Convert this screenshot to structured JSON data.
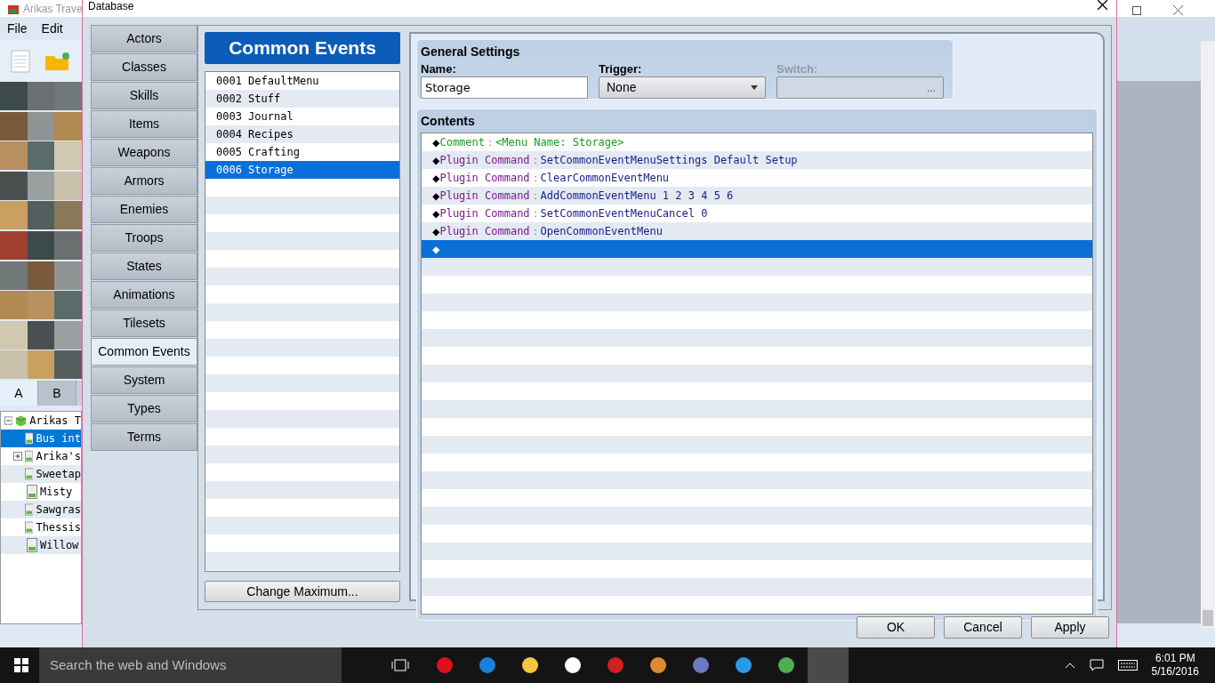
{
  "back_window": {
    "title": "Arikas Trave",
    "menu": [
      "File",
      "Edit"
    ],
    "tabs": [
      {
        "label": "A",
        "selected": true
      },
      {
        "label": "B",
        "selected": false
      }
    ],
    "tree": {
      "label": "Arikas T",
      "expanded": true,
      "children": [
        {
          "label": "Bus int",
          "selected": true
        },
        {
          "label": "Arika's",
          "selected": false,
          "expanded": false
        },
        {
          "label": "Sweetap",
          "selected": false
        },
        {
          "label": "Misty",
          "selected": false
        },
        {
          "label": "Sawgras",
          "selected": false
        },
        {
          "label": "Thessis",
          "selected": false
        },
        {
          "label": "Willow",
          "selected": false
        }
      ]
    }
  },
  "dialog": {
    "title": "Database",
    "categories": [
      {
        "label": "Actors",
        "selected": false
      },
      {
        "label": "Classes",
        "selected": false
      },
      {
        "label": "Skills",
        "selected": false
      },
      {
        "label": "Items",
        "selected": false
      },
      {
        "label": "Weapons",
        "selected": false
      },
      {
        "label": "Armors",
        "selected": false
      },
      {
        "label": "Enemies",
        "selected": false
      },
      {
        "label": "Troops",
        "selected": false
      },
      {
        "label": "States",
        "selected": false
      },
      {
        "label": "Animations",
        "selected": false
      },
      {
        "label": "Tilesets",
        "selected": false
      },
      {
        "label": "Common Events",
        "selected": true
      },
      {
        "label": "System",
        "selected": false
      },
      {
        "label": "Types",
        "selected": false
      },
      {
        "label": "Terms",
        "selected": false
      }
    ],
    "list_title": "Common Events",
    "events": [
      {
        "label": "0001 DefaultMenu",
        "selected": false
      },
      {
        "label": "0002 Stuff",
        "selected": false
      },
      {
        "label": "0003 Journal",
        "selected": false
      },
      {
        "label": "0004 Recipes",
        "selected": false
      },
      {
        "label": "0005 Crafting",
        "selected": false
      },
      {
        "label": "0006 Storage",
        "selected": true
      }
    ],
    "change_maximum": "Change Maximum...",
    "general_settings": {
      "title": "General Settings",
      "name_label": "Name:",
      "name_value": "Storage",
      "trigger_label": "Trigger:",
      "trigger_value": "None",
      "switch_label": "Switch:",
      "switch_disabled": true,
      "switch_button": "..."
    },
    "contents": {
      "title": "Contents",
      "commands": [
        {
          "kind": "comment",
          "marker": "◆",
          "label": "Comment",
          "sep": "：",
          "text": "<Menu Name: Storage>",
          "selected": false
        },
        {
          "kind": "plugin",
          "marker": "◆",
          "label": "Plugin Command",
          "sep": "：",
          "text": "SetCommonEventMenuSettings Default Setup",
          "selected": false
        },
        {
          "kind": "plugin",
          "marker": "◆",
          "label": "Plugin Command",
          "sep": "：",
          "text": "ClearCommonEventMenu",
          "selected": false
        },
        {
          "kind": "plugin",
          "marker": "◆",
          "label": "Plugin Command",
          "sep": "：",
          "text": "AddCommonEventMenu 1 2 3 4 5 6",
          "selected": false
        },
        {
          "kind": "plugin",
          "marker": "◆",
          "label": "Plugin Command",
          "sep": "：",
          "text": "SetCommonEventMenuCancel 0",
          "selected": false
        },
        {
          "kind": "plugin",
          "marker": "◆",
          "label": "Plugin Command",
          "sep": "：",
          "text": "OpenCommonEventMenu",
          "selected": false
        },
        {
          "kind": "empty",
          "marker": "◆",
          "selected": true
        }
      ]
    },
    "buttons": [
      "OK",
      "Cancel",
      "Apply"
    ]
  },
  "taskbar": {
    "search_placeholder": "Search the web and Windows",
    "time": "6:01 PM",
    "date": "5/16/2016"
  }
}
